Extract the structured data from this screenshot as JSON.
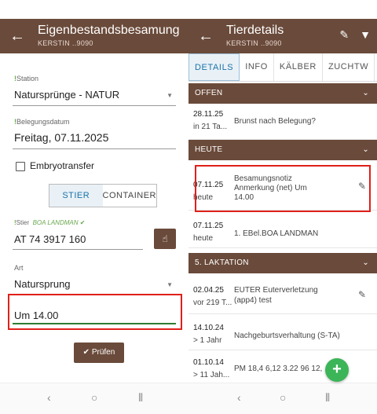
{
  "left": {
    "appbar": {
      "title": "Eigenbestandsbesamung",
      "subtitle": "KERSTIN ..9090"
    },
    "station": {
      "label": "Station",
      "value": "Natursprünge - NATUR"
    },
    "belegungsdatum": {
      "label": "Belegungsdatum",
      "value": "Freitag, 07.11.2025"
    },
    "embryotransfer": {
      "label": "Embryotransfer",
      "checked": false
    },
    "toggle": {
      "options": [
        "STIER",
        "CONTAINER"
      ],
      "selected": "STIER"
    },
    "stier": {
      "label": "Stier",
      "name": "BOA LANDMAN",
      "value": "AT 74 3917 160"
    },
    "art": {
      "label": "Art",
      "value": "Natursprung"
    },
    "anmerkung": {
      "value": "Um 14.00"
    },
    "pruefen_label": "Prüfen"
  },
  "right": {
    "appbar": {
      "title": "Tierdetails",
      "subtitle": "KERSTIN ..9090"
    },
    "tabs": [
      "DETAILS",
      "INFO",
      "KÄLBER",
      "ZUCHTW"
    ],
    "sections": {
      "offen": "OFFEN",
      "heute": "HEUTE",
      "laktation": "5. LAKTATION"
    },
    "rows": [
      {
        "date": "28.11.25",
        "rel": "in 21 Ta...",
        "text": "Brunst nach Belegung?"
      },
      {
        "date": "07.11.25",
        "rel": "heute",
        "text1": "Besamungsnotiz",
        "text2": "Anmerkung (net) Um",
        "text3": "14.00"
      },
      {
        "date": "07.11.25",
        "rel": "heute",
        "text": "1. EBel.BOA LANDMAN"
      },
      {
        "date": "02.04.25",
        "rel": "vor 219 T...",
        "text1": "EUTER Euterverletzung",
        "text2": "(app4) test"
      },
      {
        "date": "14.10.24",
        "rel": "> 1 Jahr",
        "text": "Nachgeburtsverhaltung (S-TA)"
      },
      {
        "date": "01.10.14",
        "rel": "> 11 Jah...",
        "text": "PM  18,4 6,12 3.22  96 12,"
      }
    ]
  },
  "colors": {
    "brown": "#6a4a3a",
    "highlight": "#e0201a",
    "green": "#3cb558",
    "blue": "#1a73a8"
  }
}
